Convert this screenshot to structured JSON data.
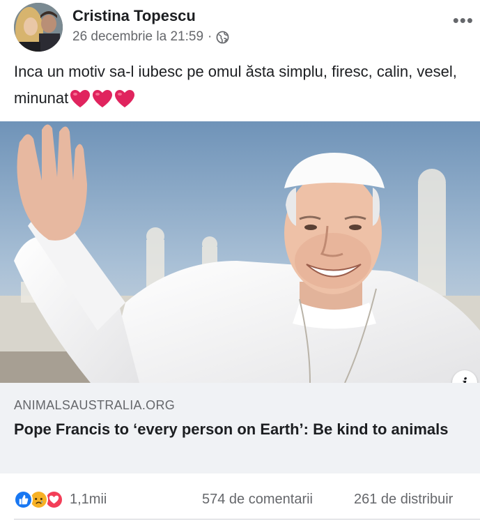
{
  "post": {
    "author": "Cristina Topescu",
    "timestamp": "26 decembrie la 21:59",
    "separator": "·",
    "privacy_icon": "globe-icon",
    "more_label": "•••",
    "text": "Inca un motiv sa-l iubesc pe omul ăsta simplu, firesc, calin, vesel, minunat",
    "emojis": [
      "heart-icon",
      "heart-icon",
      "heart-icon"
    ]
  },
  "link": {
    "domain": "ANIMALSAUSTRALIA.ORG",
    "title": "Pope Francis to ‘every person on Earth’: Be kind to animals",
    "info_label": "i"
  },
  "engagement": {
    "reactions": [
      "like-icon",
      "sad-icon",
      "love-icon"
    ],
    "reaction_count": "1,1mii",
    "comments": "574 de comentarii",
    "shares": "261 de distribuir"
  },
  "colors": {
    "like": "#1877f2",
    "love": "#f33e58",
    "sad": "#f7b125",
    "muted_text": "#65676b",
    "card_bg": "#f0f2f5"
  }
}
